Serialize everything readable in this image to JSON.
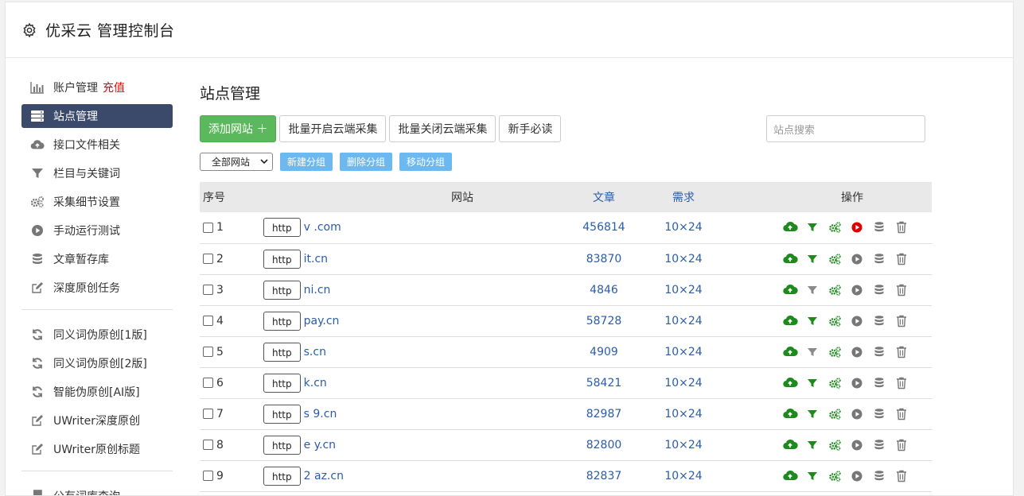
{
  "app": {
    "title": "优采云 管理控制台"
  },
  "sidebar": {
    "items": [
      {
        "label": "账户管理",
        "extra": "充值",
        "icon": "bar-chart-icon"
      },
      {
        "label": "站点管理",
        "icon": "server-icon",
        "active": true
      },
      {
        "label": "接口文件相关",
        "icon": "cloud-upload-icon"
      },
      {
        "label": "栏目与关键词",
        "icon": "filter-icon"
      },
      {
        "label": "采集细节设置",
        "icon": "gears-icon"
      },
      {
        "label": "手动运行测试",
        "icon": "play-circle-icon"
      },
      {
        "label": "文章暂存库",
        "icon": "database-icon"
      },
      {
        "label": "深度原创任务",
        "icon": "edit-icon"
      }
    ],
    "items2": [
      {
        "label": "同义词伪原创[1版]",
        "icon": "refresh-icon"
      },
      {
        "label": "同义词伪原创[2版]",
        "icon": "refresh-icon"
      },
      {
        "label": "智能伪原创[AI版]",
        "icon": "refresh-icon"
      },
      {
        "label": "UWriter深度原创",
        "icon": "edit-icon"
      },
      {
        "label": "UWriter原创标题",
        "icon": "edit-icon"
      }
    ],
    "items3": [
      {
        "label": "公有词库查询",
        "icon": "book-icon"
      }
    ]
  },
  "main": {
    "title": "站点管理",
    "buttons": {
      "add": "添加网站 ＋",
      "enable_cloud": "批量开启云端采集",
      "disable_cloud": "批量关闭云端采集",
      "newbie": "新手必读"
    },
    "search_placeholder": "站点搜索",
    "group_select": "全部网站",
    "group_buttons": {
      "new": "新建分组",
      "delete": "删除分组",
      "move": "移动分组"
    },
    "table": {
      "headers": {
        "idx": "序号",
        "site": "网站",
        "articles": "文章",
        "demand": "需求",
        "ops": "操作"
      },
      "rows": [
        {
          "idx": "1",
          "protocol": "http",
          "domain": "v .com",
          "articles": "456814",
          "demand": "10×24",
          "filter_active": true,
          "play_red": true
        },
        {
          "idx": "2",
          "protocol": "http",
          "domain": "it.cn",
          "articles": "83870",
          "demand": "10×24",
          "filter_active": true,
          "play_red": false
        },
        {
          "idx": "3",
          "protocol": "http",
          "domain": "ni.cn",
          "articles": "4846",
          "demand": "10×24",
          "filter_active": false,
          "play_red": false
        },
        {
          "idx": "4",
          "protocol": "http",
          "domain": "pay.cn",
          "articles": "58728",
          "demand": "10×24",
          "filter_active": true,
          "play_red": false
        },
        {
          "idx": "5",
          "protocol": "http",
          "domain": "s.cn",
          "articles": "4909",
          "demand": "10×24",
          "filter_active": false,
          "play_red": false
        },
        {
          "idx": "6",
          "protocol": "http",
          "domain": "k.cn",
          "articles": "58421",
          "demand": "10×24",
          "filter_active": true,
          "play_red": false
        },
        {
          "idx": "7",
          "protocol": "http",
          "domain": "s 9.cn",
          "articles": "82987",
          "demand": "10×24",
          "filter_active": true,
          "play_red": false
        },
        {
          "idx": "8",
          "protocol": "http",
          "domain": "e y.cn",
          "articles": "82800",
          "demand": "10×24",
          "filter_active": true,
          "play_red": false
        },
        {
          "idx": "9",
          "protocol": "http",
          "domain": "2 az.cn",
          "articles": "82837",
          "demand": "10×24",
          "filter_active": true,
          "play_red": false
        }
      ]
    }
  },
  "colors": {
    "active_nav": "#3b4a6b",
    "green": "#1e8a1e",
    "link": "#2a5caa",
    "red": "#e00000",
    "grey_icon": "#777777"
  }
}
